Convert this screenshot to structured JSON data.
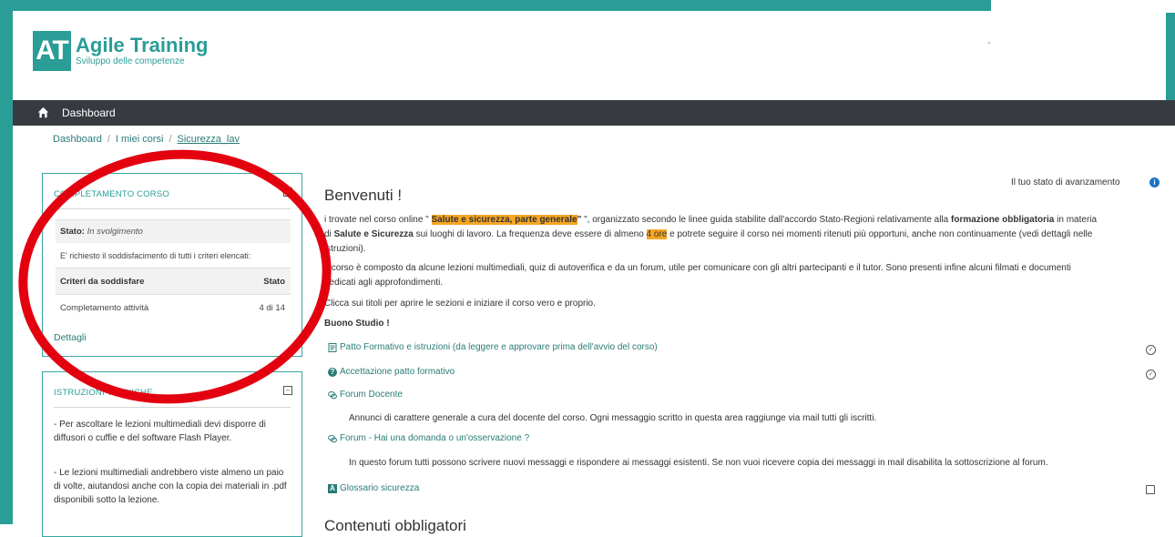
{
  "brand": {
    "logo_letters": "AT",
    "name": "Agile Training",
    "tagline": "Sviluppo delle competenze",
    "color": "#2a9d97"
  },
  "navbar": {
    "home_icon": "home-icon",
    "dashboard_label": "Dashboard"
  },
  "breadcrumb": {
    "items": [
      "Dashboard",
      "I miei corsi",
      "Sicurezza_lav"
    ]
  },
  "completion_block": {
    "title": "COMPLETAMENTO CORSO",
    "status_label": "Stato:",
    "status_value": "In svolgimento",
    "requirement": "E' richiesto il soddisfacimento di tutti i criteri elencati:",
    "criteria_header": "Criteri da soddisfare",
    "state_header": "Stato",
    "criteria_row_label": "Completamento attività",
    "criteria_row_value": "4 di 14",
    "details_link": "Dettagli"
  },
  "instructions_block": {
    "title": "ISTRUZIONI TECNICHE",
    "paragraph_1": "- Per ascoltare le lezioni multimediali devi disporre di diffusori o cuffie e del software Flash Player.",
    "paragraph_2": "- Le lezioni multimediali andrebbero viste almeno un paio di volte, aiutandosi anche con la copia dei materiali in .pdf disponibili sotto la lezione."
  },
  "main": {
    "progress_label": "Il tuo stato di avanzamento",
    "welcome": "Benvenuti !",
    "p1_a": "i trovate nel corso online \" ",
    "p1_course": "Salute e sicurezza, parte generale",
    "p1_b": " \", organizzato secondo le linee guida stabilite dall'accordo Stato-Regioni relativamente alla ",
    "p1_bold": "formazione obbligatoria",
    "p1_c": " in materia",
    "p1_d": "di ",
    "p1_bold2": "Salute e Sicurezza",
    "p1_e": " sui luoghi di lavoro. La frequenza deve essere di almeno ",
    "p1_hours": "4 ore",
    "p1_f": "  e potrete seguire il corso  nei momenti ritenuti più opportuni, anche non continuamente (vedi dettagli nelle",
    "p1_g": "istruzioni).",
    "p2_a": "Il corso è composto da alcune lezioni multimediali, quiz di autoverifica e da un forum, utile per comunicare con gli altri partecipanti e il tutor. Sono presenti infine  alcuni filmati e documenti",
    "p2_b": "dedicati agli approfondimenti.",
    "p3": "Clicca sui titoli per aprire le sezioni e iniziare il corso vero e proprio.",
    "p4": "Buono Studio !",
    "activities": [
      {
        "label": "Patto Formativo e istruzioni (da leggere e approvare prima dell'avvio del corso)",
        "icon": "document-icon"
      },
      {
        "label": "Accettazione patto formativo",
        "icon": "help-icon"
      },
      {
        "label": "Forum Docente",
        "icon": "forum-icon"
      },
      {
        "label": "Forum - Hai una domanda o un'osservazione ?",
        "icon": "forum-icon"
      },
      {
        "label": "Glossario sicurezza",
        "icon": "glossary-icon"
      }
    ],
    "forum_docente_desc": "Annunci di carattere generale a cura del docente del corso. Ogni messaggio scritto in questa area raggiunge via mail tutti gli iscritti.",
    "forum_qa_desc": "In questo forum tutti possono scrivere nuovi messaggi  e rispondere ai messaggi esistenti.  Se non vuoi ricevere copia dei messaggi in mail disabilita la sottoscrizione al forum.",
    "next_section": "Contenuti obbligatori"
  },
  "colors": {
    "accent": "#2a9d97",
    "navbar": "#373b41",
    "highlight": "#f5a623",
    "annotation": "#e3000f"
  }
}
